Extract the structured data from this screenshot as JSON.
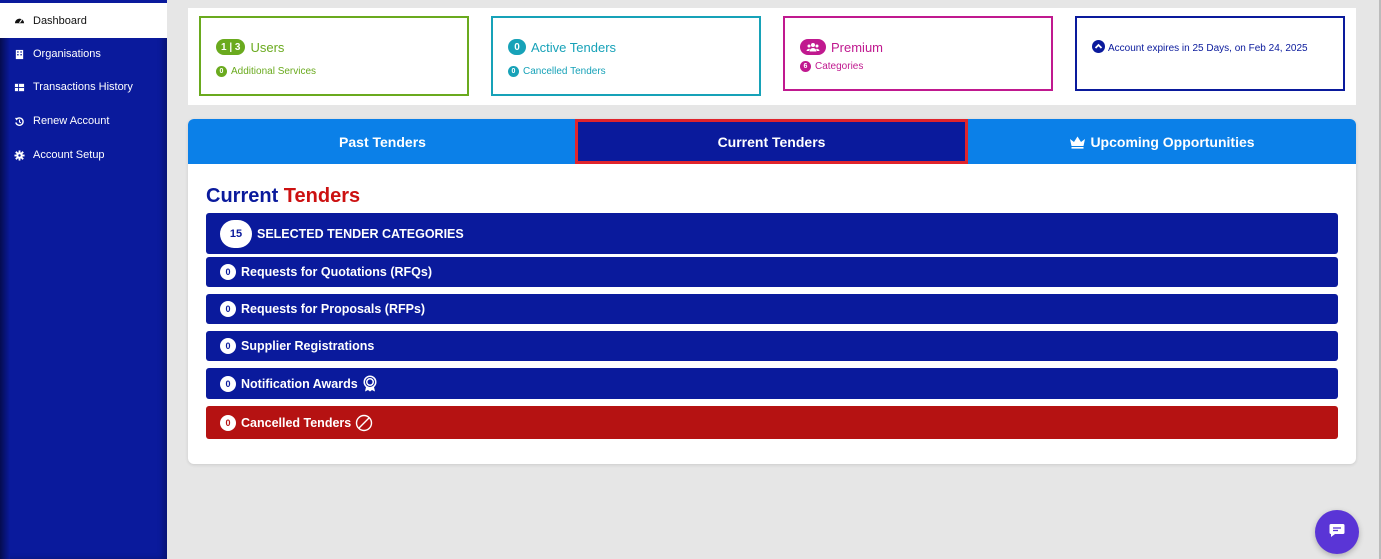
{
  "sidebar": {
    "items": [
      {
        "label": "Dashboard",
        "icon": "dashboard-icon",
        "active": true
      },
      {
        "label": "Organisations",
        "icon": "building-icon"
      },
      {
        "label": "Transactions History",
        "icon": "table-icon"
      },
      {
        "label": "Renew Account",
        "icon": "history-icon"
      },
      {
        "label": "Account Setup",
        "icon": "gear-icon"
      }
    ]
  },
  "stats": {
    "users": {
      "badge": "1 | 3",
      "title": "Users",
      "sub_count": "0",
      "sub_label": "Additional Services",
      "color": "#6aaa1e"
    },
    "tenders": {
      "badge": "0",
      "title": "Active Tenders",
      "sub_count": "0",
      "sub_label": "Cancelled Tenders",
      "color": "#17a2b8"
    },
    "premium": {
      "title": "Premium",
      "sub_count": "6",
      "sub_label": "Categories",
      "color": "#c0198f"
    },
    "account": {
      "text": "Account expires in 25 Days, on Feb 24, 2025",
      "color": "#0a1a9c"
    }
  },
  "tabs": [
    {
      "label": "Past Tenders"
    },
    {
      "label": "Current Tenders",
      "active": true
    },
    {
      "label": "Upcoming Opportunities",
      "icon": "crown-icon"
    }
  ],
  "section": {
    "title_part1": "Current",
    "title_part2": "Tenders"
  },
  "rows": {
    "categories": {
      "count": "15",
      "label": "SELECTED TENDER CATEGORIES"
    },
    "rfq": {
      "count": "0",
      "label": "Requests for Quotations (RFQs)"
    },
    "rfp": {
      "count": "0",
      "label": "Requests for Proposals (RFPs)"
    },
    "supplier": {
      "count": "0",
      "label": "Supplier Registrations"
    },
    "awards": {
      "count": "0",
      "label": "Notification Awards"
    },
    "cancelled": {
      "count": "0",
      "label": "Cancelled Tenders"
    }
  },
  "colors": {
    "primary": "#0a1a9c",
    "tab_blue": "#0b80e8",
    "danger": "#b51212",
    "chat": "#5a35d6"
  }
}
